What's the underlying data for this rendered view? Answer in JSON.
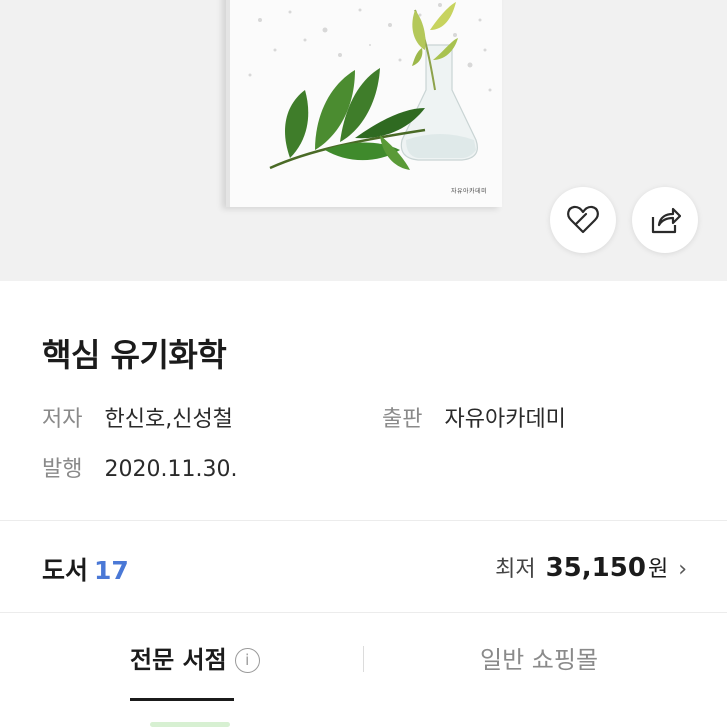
{
  "book": {
    "title": "핵심 유기화학",
    "cover_publisher_text": "자유아카데미"
  },
  "meta": {
    "author_label": "저자",
    "author_value": "한신호,신성철",
    "publisher_label": "출판",
    "publisher_value": "자유아카데미",
    "date_label": "발행",
    "date_value": "2020.11.30."
  },
  "stock": {
    "label": "도서",
    "count": "17",
    "price_label": "최저",
    "price_value": "35,150",
    "price_unit": "원",
    "chevron": "›"
  },
  "tabs": {
    "active_label": "전문 서점",
    "info_icon": "i",
    "inactive_label": "일반 쇼핑몰"
  },
  "icons": {
    "wishlist": "heart-icon",
    "share": "share-icon",
    "info": "info-icon",
    "chevron": "chevron-right-icon"
  },
  "colors": {
    "accent": "#4a78d6",
    "text": "#1b1b1b",
    "muted": "#8a8a8a",
    "hero_bg": "#f1f1f1"
  }
}
